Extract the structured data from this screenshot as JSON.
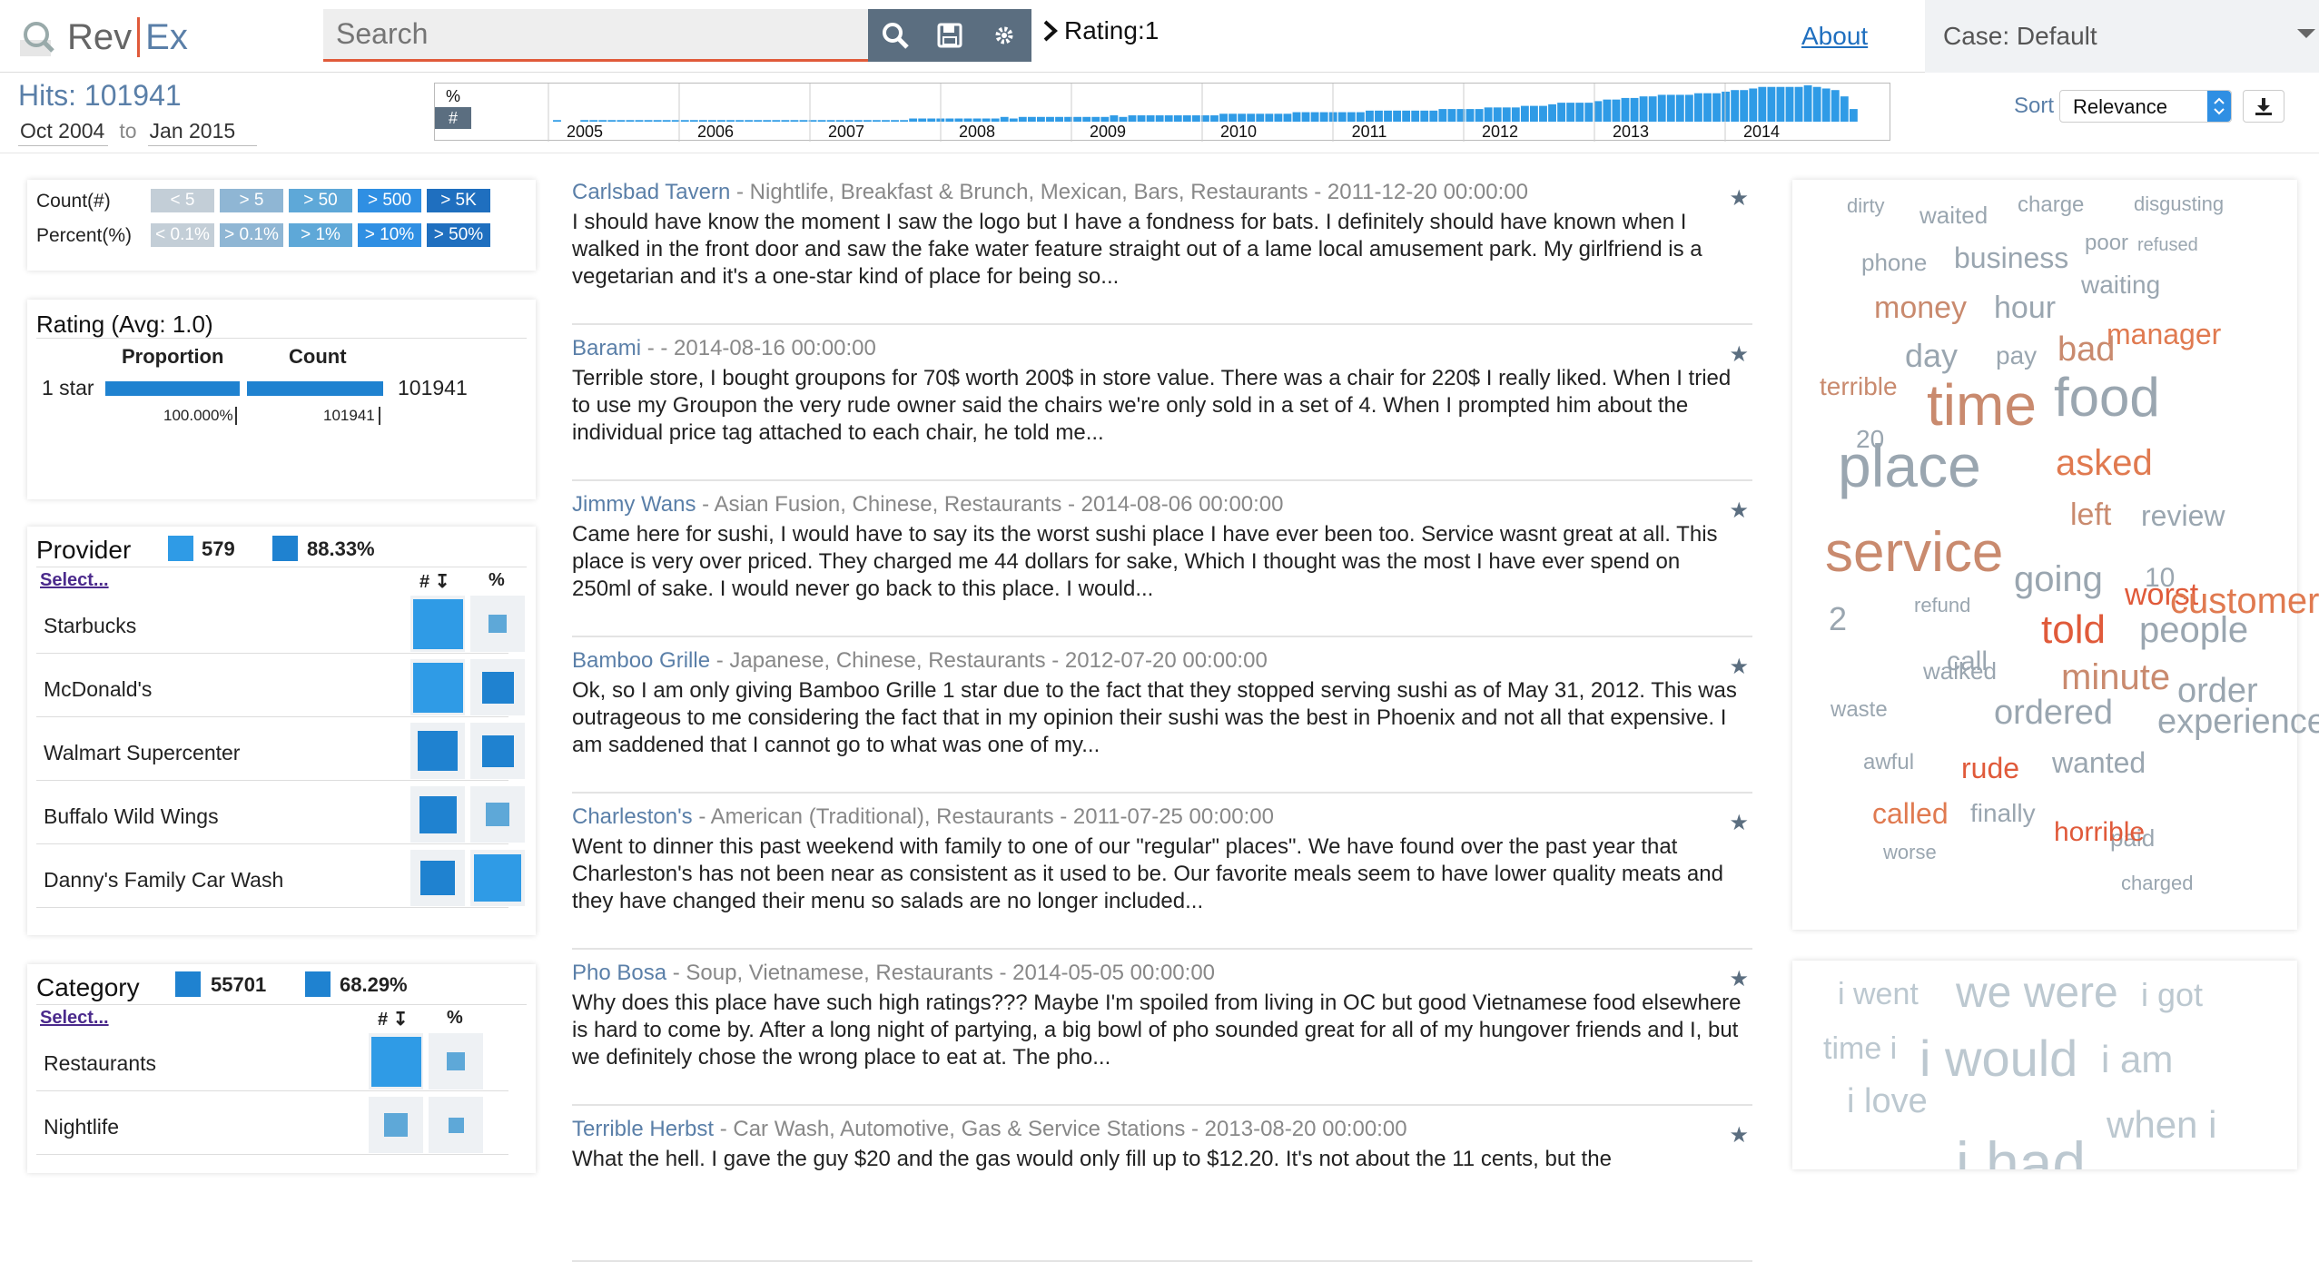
{
  "app": {
    "logo_left": "Rev",
    "logo_right": "Ex"
  },
  "search": {
    "placeholder": "Search"
  },
  "query": {
    "label": "Rating:1"
  },
  "nav": {
    "about": "About",
    "case": "Case: Default"
  },
  "summary": {
    "hits": "Hits: 101941",
    "date_from": "Oct 2004",
    "to": "to",
    "date_to": "Jan 2015"
  },
  "timeline": {
    "pct_btn": "%",
    "num_btn": "#",
    "years": [
      "2005",
      "2006",
      "2007",
      "2008",
      "2009",
      "2010",
      "2011",
      "2012",
      "2013",
      "2014"
    ],
    "bars": [
      0,
      1,
      0,
      0,
      1,
      1,
      1,
      1,
      1,
      1,
      1,
      1,
      1,
      1,
      1,
      1,
      1,
      1,
      1,
      1,
      1,
      1,
      1,
      1,
      1,
      1,
      1,
      1,
      1,
      1,
      1,
      1,
      1,
      1,
      1,
      1,
      1,
      1,
      1,
      1,
      2,
      2,
      2,
      2,
      2,
      2,
      2,
      2,
      2,
      2,
      3,
      2,
      3,
      3,
      3,
      3,
      3,
      3,
      3,
      3,
      3,
      3,
      4,
      3,
      4,
      4,
      4,
      4,
      4,
      4,
      4,
      4,
      4,
      4,
      5,
      5,
      5,
      5,
      5,
      5,
      5,
      5,
      6,
      6,
      6,
      6,
      6,
      6,
      6,
      6,
      7,
      7,
      7,
      7,
      7,
      7,
      7,
      7,
      8,
      8,
      8,
      8,
      8,
      9,
      9,
      9,
      9,
      10,
      10,
      10,
      11,
      12,
      12,
      12,
      12,
      13,
      14,
      14,
      15,
      15,
      16,
      16,
      17,
      17,
      17,
      17,
      18,
      18,
      18,
      19,
      20,
      20,
      21,
      22,
      22,
      22,
      22,
      22,
      23,
      22,
      21,
      20,
      16,
      8
    ]
  },
  "sort": {
    "label": "Sort",
    "value": "Relevance"
  },
  "legend": {
    "count_label": "Count(#)",
    "count_chips": [
      "< 5",
      "> 5",
      "> 50",
      "> 500",
      "> 5K"
    ],
    "pct_label": "Percent(%)",
    "pct_chips": [
      "< 0.1%",
      "> 0.1%",
      "> 1%",
      "> 10%",
      "> 50%"
    ]
  },
  "rating": {
    "title": "Rating (Avg: 1.0)",
    "proportion": "Proportion",
    "count": "Count",
    "rows": [
      {
        "label": "1 star",
        "count": "101941",
        "pct": "100.000%",
        "count_small": "101941",
        "fraction": 1.0
      }
    ]
  },
  "provider": {
    "title": "Provider",
    "total": "579",
    "pct": "88.33%",
    "select": "Select...",
    "col_num": "#",
    "col_pct": "%",
    "rows": [
      {
        "name": "Starbucks",
        "count_level": 0.95,
        "pct_level": 0.35
      },
      {
        "name": "McDonald's",
        "count_level": 0.95,
        "pct_level": 0.6
      },
      {
        "name": "Walmart Supercenter",
        "count_level": 0.75,
        "pct_level": 0.6
      },
      {
        "name": "Buffalo Wild Wings",
        "count_level": 0.7,
        "pct_level": 0.45
      },
      {
        "name": "Danny's Family Car Wash",
        "count_level": 0.65,
        "pct_level": 0.9
      }
    ]
  },
  "category": {
    "title": "Category",
    "total": "55701",
    "pct": "68.29%",
    "select": "Select...",
    "col_num": "#",
    "col_pct": "%",
    "rows": [
      {
        "name": "Restaurants",
        "count_level": 0.95,
        "pct_level": 0.35
      },
      {
        "name": "Nightlife",
        "count_level": 0.45,
        "pct_level": 0.3
      }
    ]
  },
  "reviews": [
    {
      "name": "Carlsbad Tavern",
      "meta": " - Nightlife, Breakfast & Brunch, Mexican, Bars, Restaurants - 2011-12-20 00:00:00",
      "text": "I should have know the moment I saw the logo but I have a fondness for bats. I definitely should have known when I walked in the front door and saw the fake water feature straight out of a lame local amusement park. My girlfriend is a vegetarian and it's a one-star kind of place for being so..."
    },
    {
      "name": "Barami",
      "meta": " - - 2014-08-16 00:00:00",
      "text": "Terrible store, I bought groupons for 70$ worth 200$ in store value. There was a chair for 220$ I really liked. When I tried to use my Groupon the very rude owner said the chairs we're only sold in a set of 4. When I prompted him about the individual price tag attached to each chair, he told me..."
    },
    {
      "name": "Jimmy Wans",
      "meta": " - Asian Fusion, Chinese, Restaurants - 2014-08-06 00:00:00",
      "text": "Came here for sushi, I would have to say its the worst sushi place I have ever been too. Service wasnt great at all. This place is very over priced. They charged me 44 dollars for sake, Which I thought was the most I have ever spend on 250ml of sake. I would never go back to this place. I would..."
    },
    {
      "name": "Bamboo Grille",
      "meta": " - Japanese, Chinese, Restaurants - 2012-07-20 00:00:00",
      "text": "Ok, so I am only giving Bamboo Grille 1 star due to the fact that they stopped serving sushi as of May 31, 2012. This was outrageous to me considering the fact that in my opinion their sushi was the best in Phoenix and not all that expensive. I am saddened that I cannot go to what was one of my..."
    },
    {
      "name": "Charleston's",
      "meta": " - American (Traditional), Restaurants - 2011-07-25 00:00:00",
      "text": "Went to dinner this past weekend with family to one of our \"regular\" places\". We have found over the past year that Charleston's has not been near as consistent as it used to be. Our favorite meals seem to have lower quality meats and they have changed their menu so salads are no longer included..."
    },
    {
      "name": "Pho Bosa",
      "meta": " - Soup, Vietnamese, Restaurants - 2014-05-05 00:00:00",
      "text": "Why does this place have such high ratings??? Maybe I'm spoiled from living in OC but good Vietnamese food elsewhere is hard to come by. After a long night of partying, a big bowl of pho sounded great for all of my hungover friends and I, but we definitely chose the wrong place to eat at. The pho..."
    },
    {
      "name": "Terrible Herbst",
      "meta": " - Car Wash, Automotive, Gas & Service Stations - 2013-08-20 00:00:00",
      "text": "What the hell. I gave the guy $20 and the gas would only fill up to $12.20. It's not about the 11 cents, but the"
    }
  ],
  "wordcloud": [
    {
      "t": "dirty",
      "c": "#9aa6b0",
      "s": 22
    },
    {
      "t": "waited",
      "c": "#9aa6b0",
      "s": 26
    },
    {
      "t": "charge",
      "c": "#9aa6b0",
      "s": 24
    },
    {
      "t": "disgusting",
      "c": "#9aa6b0",
      "s": 22
    },
    {
      "t": "poor",
      "c": "#9aa6b0",
      "s": 24
    },
    {
      "t": "refused",
      "c": "#9aa6b0",
      "s": 20
    },
    {
      "t": "phone",
      "c": "#9aa6b0",
      "s": 26
    },
    {
      "t": "business",
      "c": "#9aa6b0",
      "s": 32
    },
    {
      "t": "waiting",
      "c": "#9aa6b0",
      "s": 28
    },
    {
      "t": "money",
      "c": "#c98a6e",
      "s": 34
    },
    {
      "t": "hour",
      "c": "#9aa6b0",
      "s": 34
    },
    {
      "t": "manager",
      "c": "#e07a50",
      "s": 32
    },
    {
      "t": "day",
      "c": "#9aa6b0",
      "s": 36
    },
    {
      "t": "pay",
      "c": "#9aa6b0",
      "s": 28
    },
    {
      "t": "bad",
      "c": "#c98a6e",
      "s": 38
    },
    {
      "t": "terrible",
      "c": "#c98a6e",
      "s": 28
    },
    {
      "t": "time",
      "c": "#c98a6e",
      "s": 64
    },
    {
      "t": "food",
      "c": "#9aa6b0",
      "s": 60
    },
    {
      "t": "20",
      "c": "#9aa6b0",
      "s": 28
    },
    {
      "t": "place",
      "c": "#9aa6b0",
      "s": 66
    },
    {
      "t": "asked",
      "c": "#e07a50",
      "s": 40
    },
    {
      "t": "left",
      "c": "#c98a6e",
      "s": 34
    },
    {
      "t": "review",
      "c": "#9aa6b0",
      "s": 32
    },
    {
      "t": "service",
      "c": "#c98a6e",
      "s": 62
    },
    {
      "t": "going",
      "c": "#9aa6b0",
      "s": 40
    },
    {
      "t": "10",
      "c": "#9aa6b0",
      "s": 30
    },
    {
      "t": "worst",
      "c": "#e05a3a",
      "s": 34
    },
    {
      "t": "customer",
      "c": "#e07a50",
      "s": 40
    },
    {
      "t": "2",
      "c": "#9aa6b0",
      "s": 36
    },
    {
      "t": "refund",
      "c": "#9aa6b0",
      "s": 22
    },
    {
      "t": "call",
      "c": "#9aa6b0",
      "s": 30
    },
    {
      "t": "told",
      "c": "#e05a3a",
      "s": 44
    },
    {
      "t": "people",
      "c": "#9aa6b0",
      "s": 40
    },
    {
      "t": "walked",
      "c": "#9aa6b0",
      "s": 26
    },
    {
      "t": "minute",
      "c": "#c98a6e",
      "s": 40
    },
    {
      "t": "order",
      "c": "#9aa6b0",
      "s": 38
    },
    {
      "t": "waste",
      "c": "#9aa6b0",
      "s": 24
    },
    {
      "t": "ordered",
      "c": "#9aa6b0",
      "s": 38
    },
    {
      "t": "experience",
      "c": "#9aa6b0",
      "s": 38
    },
    {
      "t": "awful",
      "c": "#9aa6b0",
      "s": 24
    },
    {
      "t": "rude",
      "c": "#e05a3a",
      "s": 32
    },
    {
      "t": "wanted",
      "c": "#9aa6b0",
      "s": 32
    },
    {
      "t": "called",
      "c": "#e07a50",
      "s": 32
    },
    {
      "t": "finally",
      "c": "#9aa6b0",
      "s": 28
    },
    {
      "t": "paid",
      "c": "#9aa6b0",
      "s": 26
    },
    {
      "t": "horrible",
      "c": "#e05a3a",
      "s": 30
    },
    {
      "t": "worse",
      "c": "#9aa6b0",
      "s": 22
    },
    {
      "t": "charged",
      "c": "#9aa6b0",
      "s": 22
    }
  ],
  "phrasecloud": [
    {
      "t": "i went",
      "c": "#bcc8d0",
      "s": 34
    },
    {
      "t": "we were",
      "c": "#bcc8d0",
      "s": 48
    },
    {
      "t": "i got",
      "c": "#bcc8d0",
      "s": 36
    },
    {
      "t": "time i",
      "c": "#bcc8d0",
      "s": 34
    },
    {
      "t": "i would",
      "c": "#bcc8d0",
      "s": 56
    },
    {
      "t": "i am",
      "c": "#bcc8d0",
      "s": 42
    },
    {
      "t": "i love",
      "c": "#bcc8d0",
      "s": 38
    },
    {
      "t": "when i",
      "c": "#bcc8d0",
      "s": 42
    },
    {
      "t": "i had",
      "c": "#bcc8d0",
      "s": 66
    }
  ]
}
